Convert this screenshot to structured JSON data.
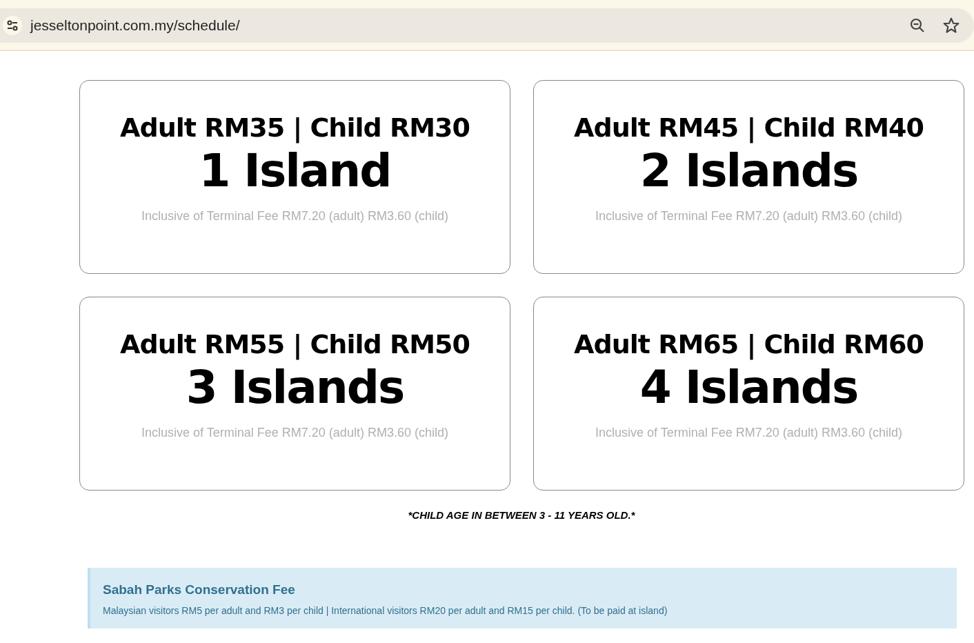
{
  "browser": {
    "url": "jesseltonpoint.com.my/schedule/"
  },
  "packages": [
    {
      "price": "Adult RM35 | Child RM30",
      "title": "1 Island",
      "note": "Inclusive of Terminal Fee RM7.20 (adult) RM3.60 (child)"
    },
    {
      "price": "Adult RM45 | Child RM40",
      "title": "2 Islands",
      "note": "Inclusive of Terminal Fee RM7.20 (adult) RM3.60 (child)"
    },
    {
      "price": "Adult RM55 | Child RM50",
      "title": "3 Islands",
      "note": "Inclusive of Terminal Fee RM7.20 (adult) RM3.60 (child)"
    },
    {
      "price": "Adult RM65 | Child RM60",
      "title": "4 Islands",
      "note": "Inclusive of Terminal Fee RM7.20 (adult) RM3.60 (child)"
    }
  ],
  "child_age_note": "*CHILD AGE IN BETWEEN 3 - 11 YEARS OLD.*",
  "info_box": {
    "title": "Sabah Parks Conservation Fee",
    "text": "Malaysian visitors RM5 per adult and RM3 per child | International visitors RM20 per adult and RM15 per child. (To be paid at island)"
  }
}
